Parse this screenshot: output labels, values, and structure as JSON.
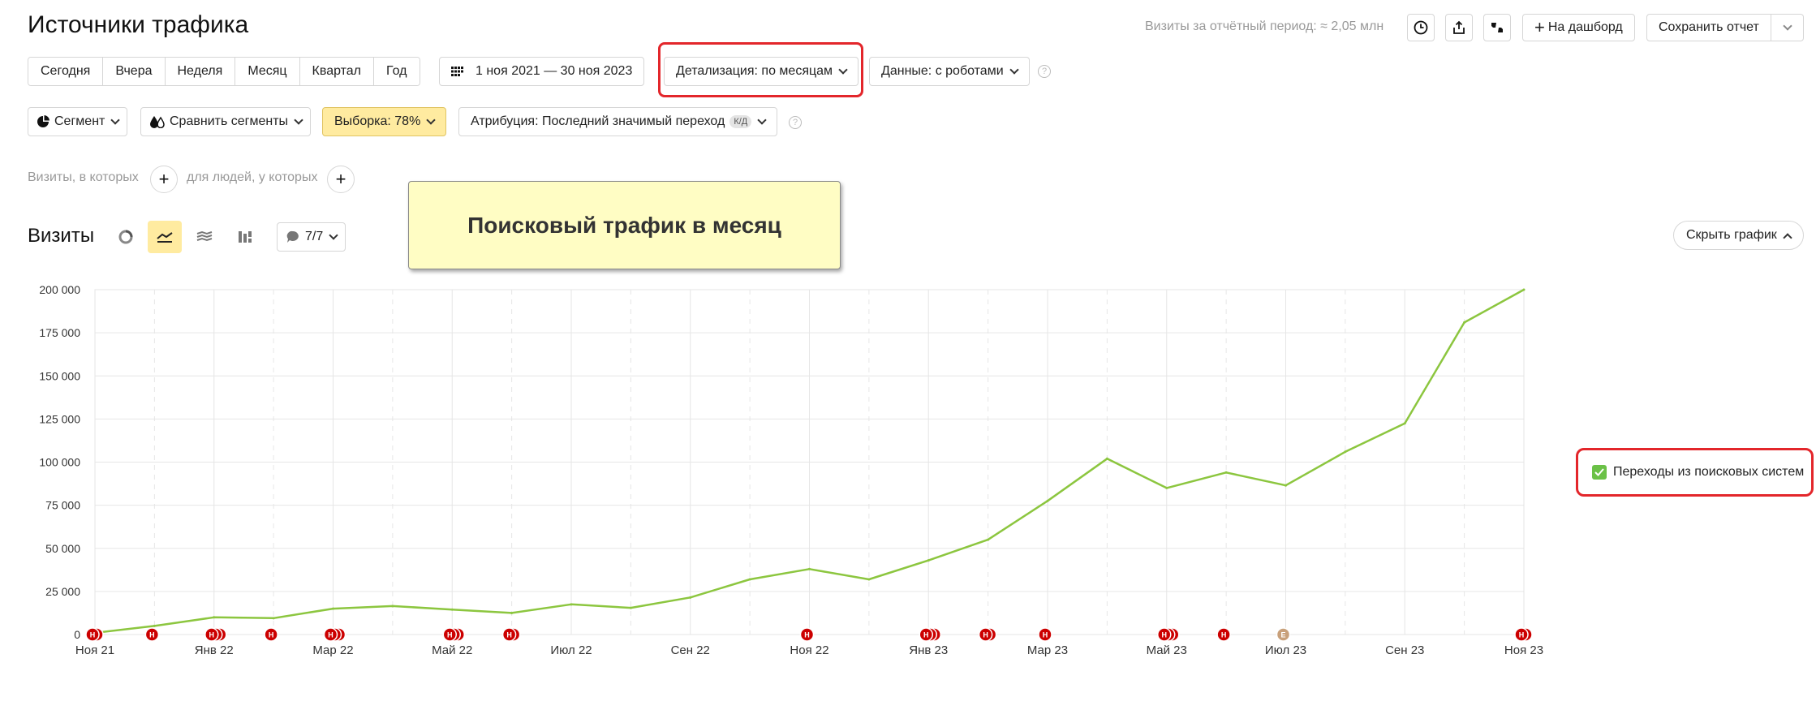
{
  "header": {
    "title": "Источники трафика",
    "period_info": "Визиты за отчётный период: ≈ 2,05 млн",
    "dashboard_label": "На дашборд",
    "save_label": "Сохранить отчет"
  },
  "periods": [
    "Сегодня",
    "Вчера",
    "Неделя",
    "Месяц",
    "Квартал",
    "Год"
  ],
  "date_range": "1 ноя 2021 — 30 ноя 2023",
  "detail_label": "Детализация: по месяцам",
  "data_label": "Данные: с роботами",
  "help_glyph": "?",
  "segments": {
    "segment_label": "Сегмент",
    "compare_label": "Сравнить сегменты",
    "sample_label": "Выборка: 78%",
    "attribution_label": "Атрибуция: Последний значимый переход",
    "attribution_badge": "К/Д"
  },
  "filters": {
    "visits_label": "Визиты, в которых",
    "people_label": "для людей, у которых",
    "plus_glyph": "+"
  },
  "callout": "Поисковый трафик в месяц",
  "chart_header": {
    "title": "Визиты",
    "annotations_count": "7/7",
    "hide_label": "Скрыть график"
  },
  "legend": {
    "label": "Переходы из поисковых систем"
  },
  "colors": {
    "line": "#8cc63f",
    "highlight": "#e3262b",
    "marker": "#cc0000",
    "marker_alt": "#c8a07a"
  },
  "chart_data": {
    "type": "line",
    "title": "",
    "xlabel": "",
    "ylabel": "",
    "ylim": [
      0,
      200000
    ],
    "yticks": [
      0,
      25000,
      50000,
      75000,
      100000,
      125000,
      150000,
      175000,
      200000
    ],
    "ytick_labels": [
      "0",
      "25 000",
      "50 000",
      "75 000",
      "100 000",
      "125 000",
      "150 000",
      "175 000",
      "200 000"
    ],
    "x": [
      "2021-11",
      "2021-12",
      "2022-01",
      "2022-02",
      "2022-03",
      "2022-04",
      "2022-05",
      "2022-06",
      "2022-07",
      "2022-08",
      "2022-09",
      "2022-10",
      "2022-11",
      "2022-12",
      "2023-01",
      "2023-02",
      "2023-03",
      "2023-04",
      "2023-05",
      "2023-06",
      "2023-07",
      "2023-08",
      "2023-09",
      "2023-10",
      "2023-11"
    ],
    "xtick_labels": [
      "Ноя 21",
      "Янв 22",
      "Мар 22",
      "Май 22",
      "Июл 22",
      "Сен 22",
      "Ноя 22",
      "Янв 23",
      "Мар 23",
      "Май 23",
      "Июл 23",
      "Сен 23",
      "Ноя 23"
    ],
    "series": [
      {
        "name": "Переходы из поисковых систем",
        "values": [
          1000,
          5000,
          10000,
          9500,
          15000,
          16500,
          14500,
          12500,
          17500,
          15500,
          21500,
          32000,
          38000,
          32000,
          43000,
          55000,
          77500,
          102000,
          85000,
          94000,
          86500,
          106000,
          122500,
          181000,
          200000
        ]
      }
    ],
    "grid": true,
    "legend_position": "right",
    "annotation_markers": [
      {
        "month": "2021-11",
        "count": 2,
        "glyph": "Н"
      },
      {
        "month": "2021-12",
        "count": 1,
        "glyph": "Н"
      },
      {
        "month": "2022-01",
        "count": 3,
        "glyph": "Н"
      },
      {
        "month": "2022-02",
        "count": 1,
        "glyph": "Н"
      },
      {
        "month": "2022-03",
        "count": 3,
        "glyph": "Н"
      },
      {
        "month": "2022-05",
        "count": 3,
        "glyph": "Н"
      },
      {
        "month": "2022-06",
        "count": 2,
        "glyph": "Н"
      },
      {
        "month": "2022-11",
        "count": 1,
        "glyph": "Н"
      },
      {
        "month": "2023-01",
        "count": 3,
        "glyph": "Н"
      },
      {
        "month": "2023-02",
        "count": 2,
        "glyph": "Н"
      },
      {
        "month": "2023-03",
        "count": 1,
        "glyph": "Н"
      },
      {
        "month": "2023-05",
        "count": 3,
        "glyph": "Н"
      },
      {
        "month": "2023-06",
        "count": 1,
        "glyph": "Н"
      },
      {
        "month": "2023-07",
        "count": 1,
        "glyph": "Е"
      },
      {
        "month": "2023-11",
        "count": 2,
        "glyph": "Н"
      }
    ]
  }
}
